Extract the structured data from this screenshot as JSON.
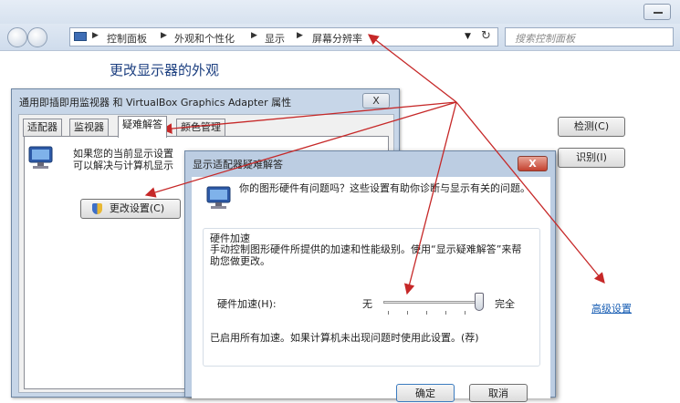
{
  "breadcrumb": [
    "控制面板",
    "外观和个性化",
    "显示",
    "屏幕分辨率"
  ],
  "search": {
    "placeholder": "搜索控制面板"
  },
  "background_window": {
    "title": "更改显示器的外观",
    "detect_button": "检测(C)",
    "identify_button": "识别(I)",
    "advanced_link": "高级设置"
  },
  "properties_dialog": {
    "title": "通用即插即用监视器 和 VirtualBox Graphics Adapter 属性",
    "close_label": "X",
    "tabs": [
      "适配器",
      "监视器",
      "疑难解答",
      "颜色管理"
    ],
    "active_tab": "疑难解答",
    "text_line1": "如果您的当前显示设置",
    "text_line2": "可以解决与计算机显示",
    "change_settings_button": "更改设置(C)"
  },
  "troubleshooter_dialog": {
    "title": "显示适配器疑难解答",
    "close_label": "X",
    "intro": "你的图形硬件有问题吗？这些设置有助你诊断与显示有关的问题。",
    "group_title": "硬件加速",
    "description": "手动控制图形硬件所提供的加速和性能级别。使用“显示疑难解答”来帮助您做更改。",
    "accel_label": "硬件加速(H):",
    "slider_min_label": "无",
    "slider_max_label": "完全",
    "slider_level": 1.0,
    "status": "已启用所有加速。如果计算机未出现问题时使用此设置。(荐)",
    "ok_button": "确定",
    "cancel_button": "取消"
  },
  "colors": {
    "annotation_arrow": "#c62828",
    "link": "#1a5fb4"
  }
}
